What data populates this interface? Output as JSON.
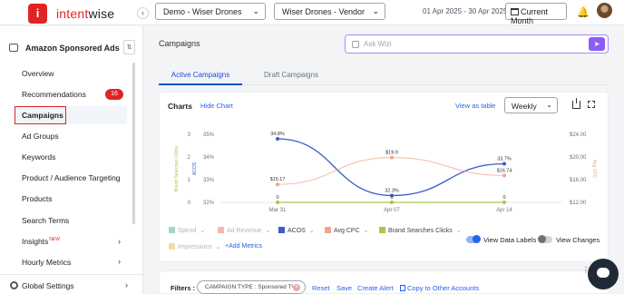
{
  "app": {
    "logo_letter": "i",
    "logo_prefix": "intent",
    "logo_suffix": "wise",
    "brand_color": "#e02424"
  },
  "header": {
    "collapse": "‹",
    "account_select": "Demo - Wiser Drones",
    "profile_select": "Wiser Drones - Vendor",
    "date_range": "01 Apr 2025 - 30 Apr 2025",
    "period_button": "Current Month"
  },
  "sidebar": {
    "section": "Amazon Sponsored Ads",
    "items": [
      {
        "label": "Overview"
      },
      {
        "label": "Recommendations",
        "badge": "16"
      },
      {
        "label": "Campaigns"
      },
      {
        "label": "Ad Groups"
      },
      {
        "label": "Keywords"
      },
      {
        "label": "Product / Audience Targeting"
      },
      {
        "label": "Products"
      },
      {
        "label": "Search Terms"
      },
      {
        "label": "Insights",
        "tag": "NEW"
      },
      {
        "label": "Hourly Metrics"
      }
    ],
    "settings": "Global Settings"
  },
  "main": {
    "title": "Campaigns",
    "ask_placeholder": "Ask Wizi",
    "tabs": [
      "Active Campaigns",
      "Draft Campaigns"
    ],
    "filters": {
      "label": "Filters :",
      "chip": "CAMPAIGN TYPE : Sponsored TV",
      "reset": "Reset",
      "save": "Save",
      "alert": "Create Alert",
      "copy": "Copy to Other Accounts"
    }
  },
  "chart_card": {
    "title": "Charts",
    "hide": "Hide Chart",
    "view_table": "View as table",
    "granularity": "Weekly",
    "legend": [
      {
        "name": "Spend",
        "color": "#9fd8c8",
        "active": false
      },
      {
        "name": "Ad Revenue",
        "color": "#f4b8ae",
        "active": false
      },
      {
        "name": "ACOS",
        "color": "#3b5bcc",
        "active": true
      },
      {
        "name": "Avg CPC",
        "color": "#f4a28c",
        "active": true
      },
      {
        "name": "Brand Searches Clicks",
        "color": "#a3c948",
        "active": true
      },
      {
        "name": "Impressions",
        "color": "#f6d7a7",
        "active": false
      }
    ],
    "add_metrics": "+Add Metrics",
    "toggle_labels": {
      "label": "View Data Labels",
      "on": true
    },
    "toggle_changes": {
      "label": "View Changes",
      "on": false
    }
  },
  "chart_data": {
    "type": "line",
    "x": [
      "Mar 31",
      "Apr 07",
      "Apr 14"
    ],
    "series": [
      {
        "name": "ACOS",
        "values": [
          34.8,
          32.3,
          33.7
        ],
        "labels": [
          "34.8%",
          "32.3%",
          "33.7%"
        ],
        "axis": "left2",
        "color": "#3b5bcc"
      },
      {
        "name": "Avg CPC",
        "values": [
          15.17,
          19.9,
          16.74
        ],
        "labels": [
          "$15.17",
          "$19.9",
          "$16.74"
        ],
        "axis": "right",
        "color": "#f4a28c"
      },
      {
        "name": "Brand Searches Clicks",
        "values": [
          0,
          0,
          0
        ],
        "labels": [
          "0",
          "0",
          "0"
        ],
        "axis": "left1",
        "color": "#a3c948"
      }
    ],
    "axes": {
      "left1": {
        "label": "Brand Searches Clicks",
        "ticks": [
          "0",
          "1",
          "2",
          "3"
        ],
        "ylim": [
          0,
          3
        ],
        "color": "#a3c948"
      },
      "left2": {
        "label": "ACOS",
        "ticks": [
          "32%",
          "33%",
          "34%",
          "35%"
        ],
        "ylim": [
          32,
          35
        ],
        "color": "#3b5bcc"
      },
      "right": {
        "label": "Avg CPC",
        "ticks": [
          "$12.00",
          "$16.00",
          "$20.00",
          "$24.00"
        ],
        "ylim": [
          12,
          24
        ],
        "color": "#f4a28c"
      }
    },
    "grid": false
  }
}
